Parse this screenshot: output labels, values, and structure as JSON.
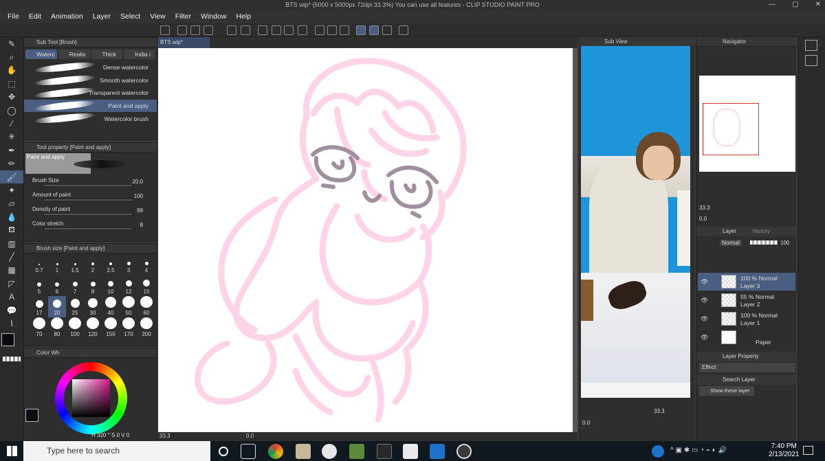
{
  "window": {
    "title": "BTS wip* (5000 x 5000px 72dpi 33.3%)  You can use all features - CLIP STUDIO PAINT PRO"
  },
  "menu": [
    "File",
    "Edit",
    "Animation",
    "Layer",
    "Select",
    "View",
    "Filter",
    "Window",
    "Help"
  ],
  "subtool": {
    "header": "Sub Tool [Brush]",
    "tabs": [
      "Waterc",
      "Realis",
      "Thick",
      "India i"
    ],
    "brushes": [
      "Dense watercolor",
      "Smooth watercolor",
      "Transparent watercolor",
      "Paint and apply",
      "Watercolor brush"
    ]
  },
  "toolprop": {
    "header": "Tool property [Paint and apply]",
    "preview_label": "Paint and apply",
    "rows": [
      {
        "label": "Brush Size",
        "value": "20.0"
      },
      {
        "label": "Amount of paint",
        "value": "100"
      },
      {
        "label": "Density of paint",
        "value": "99"
      },
      {
        "label": "Color stretch",
        "value": "8"
      }
    ]
  },
  "brushsize": {
    "header": "Brush size [Paint and apply]",
    "sizes": [
      "0.7",
      "1",
      "1.5",
      "2",
      "2.5",
      "3",
      "4",
      "5",
      "6",
      "7",
      "8",
      "10",
      "12",
      "15",
      "17",
      "20",
      "25",
      "30",
      "40",
      "50",
      "60",
      "70",
      "80",
      "100",
      "120",
      "150",
      "170",
      "200"
    ],
    "selected": "20"
  },
  "colorwheel": {
    "header": "Color Wh",
    "status": "320",
    "s": "0",
    "v": "0",
    "main_color": "#0a0a10",
    "sub_color": "#fde4ec"
  },
  "canvas": {
    "tab": "BTS wip*",
    "zoom": "33.3",
    "angle": "0.0",
    "line_color": "#ffd2e8",
    "face_color": "#a0909f"
  },
  "subview": {
    "header": "Sub View",
    "zoom": "33.3",
    "angle": "0.0"
  },
  "navigator": {
    "header": "Navigator",
    "zoom": "33.3",
    "angle": "0.0"
  },
  "layers": {
    "tabs": [
      "Layer",
      "History"
    ],
    "blend": "Normal",
    "opacity": "100",
    "items": [
      {
        "pct": "100 %",
        "mode": "Normal",
        "name": "Layer 3",
        "selected": true
      },
      {
        "pct": "55 %",
        "mode": "Normal",
        "name": "Layer 2",
        "selected": false
      },
      {
        "pct": "100 %",
        "mode": "Normal",
        "name": "Layer 1",
        "selected": false
      },
      {
        "pct": "",
        "mode": "",
        "name": "Paper",
        "selected": false
      }
    ]
  },
  "layer_property": {
    "header": "Layer Property",
    "effect": "Effect"
  },
  "search_layer": {
    "header": "Search Layer",
    "value": "Show these layer"
  },
  "taskbar": {
    "search_placeholder": "Type here to search",
    "time": "7:40 PM",
    "date": "2/13/2021"
  }
}
